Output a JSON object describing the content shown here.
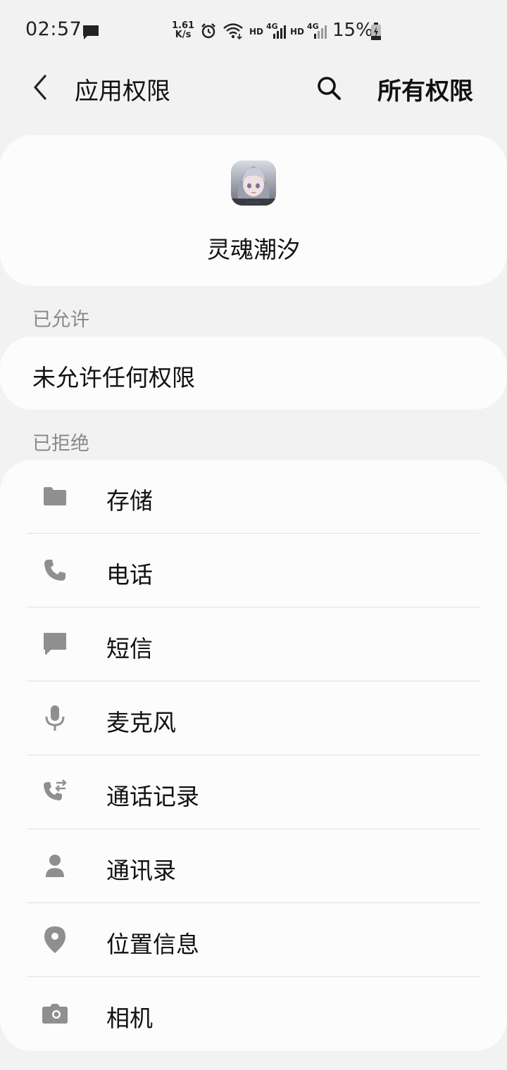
{
  "status_bar": {
    "time": "02:57",
    "net_speed_value": "1.61",
    "net_speed_unit": "K/s",
    "hd_1": "HD",
    "g4_1": "4G",
    "hd_2": "HD",
    "g4_2": "4G",
    "battery": "15%"
  },
  "header": {
    "title": "应用权限",
    "all_permissions": "所有权限"
  },
  "app": {
    "name": "灵魂潮汐"
  },
  "allowed": {
    "section_title": "已允许",
    "empty_text": "未允许任何权限"
  },
  "denied": {
    "section_title": "已拒绝",
    "items": [
      {
        "label": "存储",
        "icon": "folder-icon"
      },
      {
        "label": "电话",
        "icon": "phone-icon"
      },
      {
        "label": "短信",
        "icon": "message-icon"
      },
      {
        "label": "麦克风",
        "icon": "microphone-icon"
      },
      {
        "label": "通话记录",
        "icon": "call-log-icon"
      },
      {
        "label": "通讯录",
        "icon": "contacts-icon"
      },
      {
        "label": "位置信息",
        "icon": "location-icon"
      },
      {
        "label": "相机",
        "icon": "camera-icon"
      }
    ]
  },
  "colors": {
    "background": "#f2f2f2",
    "card": "#fcfcfc",
    "icon_gray": "#8f8f8f",
    "section_gray": "#8a8a8a"
  }
}
